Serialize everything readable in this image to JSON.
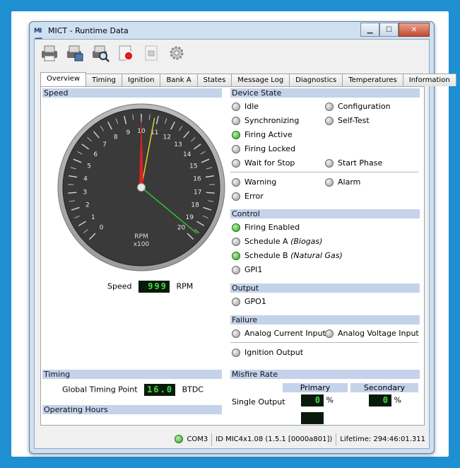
{
  "window": {
    "title": "MICT - Runtime Data",
    "app_icon": "MI CT"
  },
  "toolbar": {
    "icons": [
      "printer-icon",
      "print-preview-icon",
      "zoom-icon",
      "record-icon",
      "stop-icon",
      "settings-gear-icon"
    ]
  },
  "tabs": [
    "Overview",
    "Timing",
    "Ignition",
    "Bank A",
    "States",
    "Message Log",
    "Diagnostics",
    "Temperatures",
    "Information"
  ],
  "active_tab": "Overview",
  "speed": {
    "section": "Speed",
    "dial_labels": [
      "0",
      "1",
      "2",
      "3",
      "4",
      "5",
      "6",
      "7",
      "8",
      "9",
      "10",
      "11",
      "12",
      "13",
      "14",
      "15",
      "16",
      "17",
      "18",
      "19",
      "20"
    ],
    "unit_line1": "RPM",
    "unit_line2": "x100",
    "label": "Speed",
    "value": "999",
    "unit": "RPM",
    "needle_value": 10,
    "needle2_value": 10.8,
    "needle3_value": 19.6
  },
  "device_state": {
    "section": "Device State",
    "left": [
      {
        "label": "Idle",
        "on": false
      },
      {
        "label": "Synchronizing",
        "on": false
      },
      {
        "label": "Firing Active",
        "on": true
      },
      {
        "label": "Firing Locked",
        "on": false
      },
      {
        "label": "Wait for Stop",
        "on": false
      }
    ],
    "right": [
      {
        "label": "Configuration",
        "on": false
      },
      {
        "label": "Self-Test",
        "on": false
      },
      {
        "label": "Start Phase",
        "on": false
      }
    ],
    "warning": "Warning",
    "alarm": "Alarm",
    "error": "Error"
  },
  "control": {
    "section": "Control",
    "items": [
      {
        "label": "Firing Enabled",
        "extra": "",
        "on": true
      },
      {
        "label": "Schedule A ",
        "extra": "(Biogas)",
        "on": false
      },
      {
        "label": "Schedule B ",
        "extra": "(Natural Gas)",
        "on": true
      },
      {
        "label": "GPI1",
        "extra": "",
        "on": false
      }
    ]
  },
  "output": {
    "section": "Output",
    "item": "GPO1"
  },
  "failure": {
    "section": "Failure",
    "analog_current": "Analog Current Input",
    "analog_voltage": "Analog Voltage Input",
    "ignition_output": "Ignition Output"
  },
  "timing": {
    "section": "Timing",
    "label": "Global Timing Point",
    "value": "16.0",
    "unit": "BTDC"
  },
  "operating_hours": {
    "section": "Operating Hours"
  },
  "misfire": {
    "section": "Misfire Rate",
    "primary": "Primary",
    "secondary": "Secondary",
    "row_label": "Single Output",
    "primary_value": "0",
    "secondary_value": "0",
    "unit": "%"
  },
  "statusbar": {
    "port": "COM3",
    "id": "ID MIC4x1.08 (1.5.1 [0000a801])",
    "lifetime": "Lifetime: 294:46:01.311"
  },
  "colors": {
    "background": "#1e8fd1",
    "section_header": "#c4d2ea",
    "led_on": "#2f9f2f",
    "needle_main": "#e02020",
    "needle_yellow": "#d8d020",
    "needle_green": "#30c030"
  }
}
